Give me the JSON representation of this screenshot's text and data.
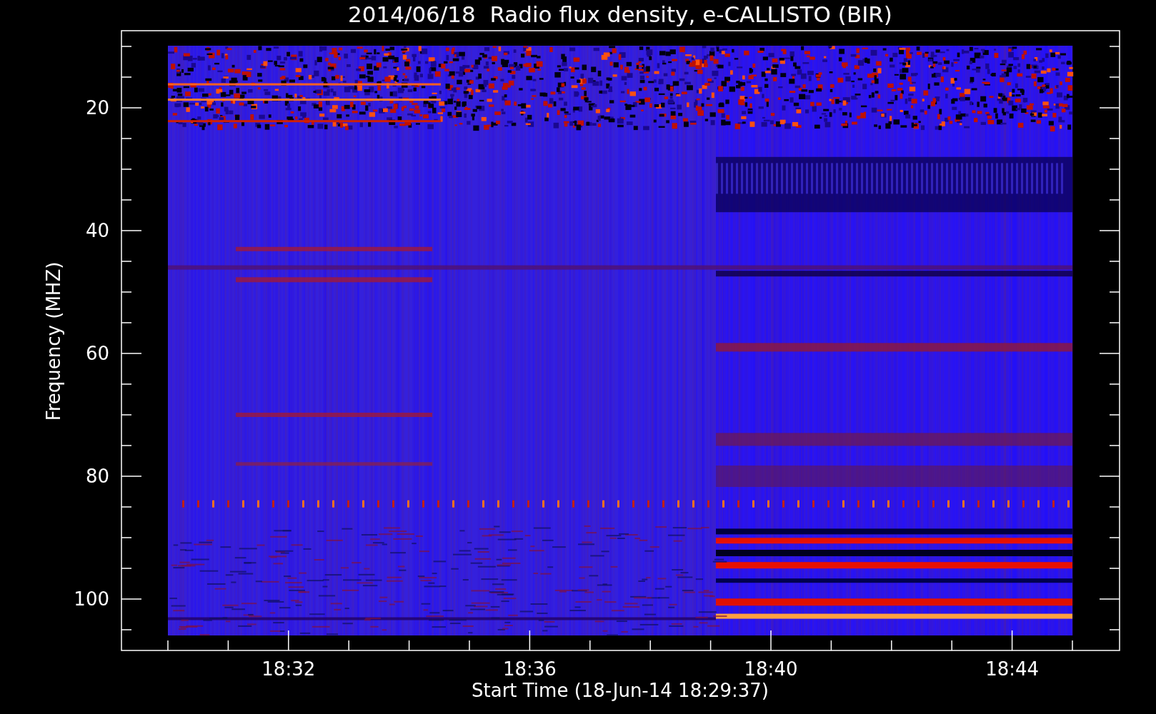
{
  "plot": {
    "title": "2014/06/18  Radio flux density, e-CALLISTO (BIR)",
    "xlabel": "Start Time (18-Jun-14 18:29:37)",
    "ylabel": "Frequency (MHZ)",
    "xticks": [
      "18:32",
      "18:36",
      "18:40",
      "18:44"
    ],
    "yticks": [
      "20",
      "40",
      "60",
      "80",
      "100"
    ]
  }
}
